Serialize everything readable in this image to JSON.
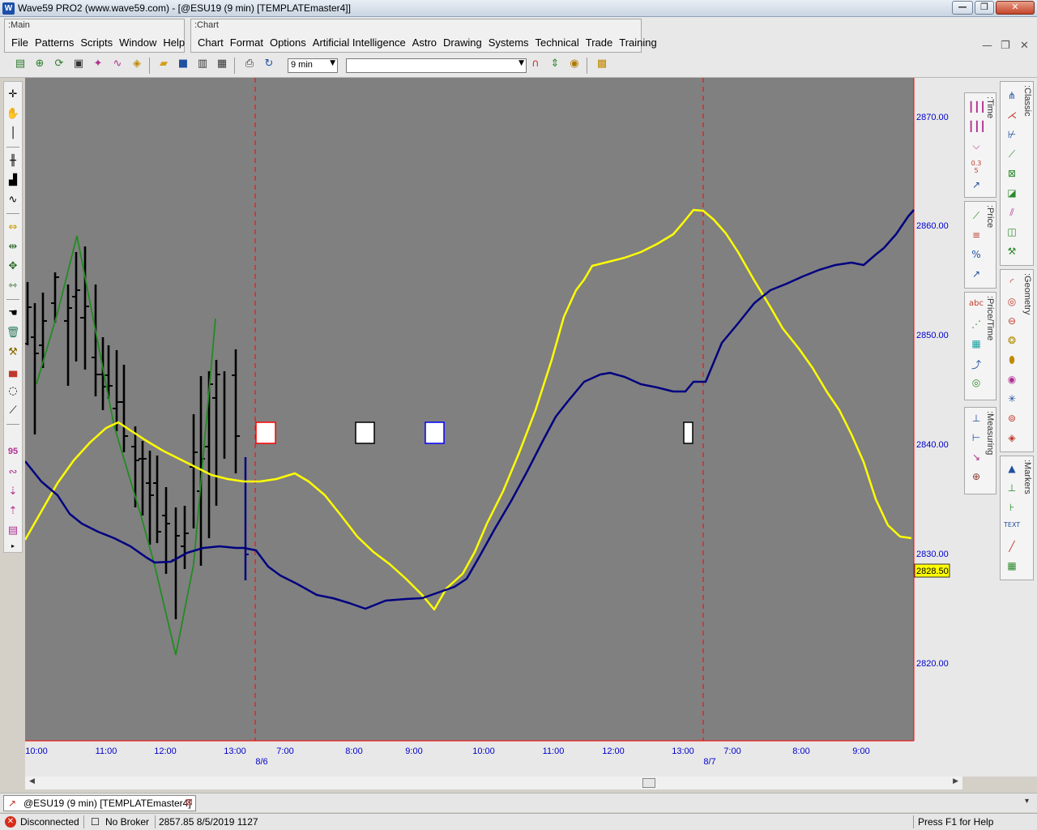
{
  "window": {
    "title": "Wave59 PRO2 (www.wave59.com) - [@ESU19 (9 min) [TEMPLATEmaster4]]",
    "app_icon": "W"
  },
  "menus": {
    "main_group_label": ":Main",
    "main_items": [
      "File",
      "Patterns",
      "Scripts",
      "Window",
      "Help"
    ],
    "chart_group_label": ":Chart",
    "chart_items": [
      "Chart",
      "Format",
      "Options",
      "Artificial Intelligence",
      "Astro",
      "Drawing",
      "Systems",
      "Technical",
      "Trade",
      "Training"
    ]
  },
  "toolbar": {
    "timeframe_value": "9 min",
    "symbol_value": ""
  },
  "left_toolbar": {
    "wave_label": "95"
  },
  "side_panels": {
    "classic_label": ":Classic",
    "time_label": ":Time",
    "price_label": ":Price",
    "geometry_label": ":Geometry",
    "pricetime_label": ":Price/Time",
    "measuring_label": ":Measuring",
    "markers_label": ":Markers",
    "percent_glyph": "%",
    "abc_glyph": "abc",
    "text_glyph": "TEXT",
    "fib_glyph": "0.3 5"
  },
  "chart_data": {
    "type": "line",
    "symbol": "@ESU19",
    "timeframe": "9 min",
    "y_ticks": [
      "2870.00",
      "2860.00",
      "2850.00",
      "2840.00",
      "2830.00",
      "2820.00"
    ],
    "ylim": [
      2813,
      2874
    ],
    "current_price_label": "2828.50",
    "x_tick_labels": [
      "10:00",
      "11:00",
      "12:00",
      "13:00",
      "7:00",
      "8:00",
      "9:00",
      "10:00",
      "11:00",
      "12:00",
      "13:00",
      "7:00",
      "8:00",
      "9:00"
    ],
    "date_labels": [
      "8/6",
      "8/7"
    ],
    "colors": {
      "background": "#808080",
      "yellow_line": "#ffff00",
      "navy_line": "#000080",
      "zigzag": "#228b22",
      "bars": "#000000",
      "session_divider": "#ff0000",
      "axis_text": "#0000cc"
    },
    "session_dividers_price_axis": true,
    "markers": [
      {
        "type": "square",
        "border": "#ff0000",
        "fill": "#ffffff"
      },
      {
        "type": "square",
        "border": "#000000",
        "fill": "#ffffff"
      },
      {
        "type": "square",
        "border": "#0000ff",
        "fill": "#ffffff"
      },
      {
        "type": "rect",
        "border": "#000000",
        "fill": "#ffffff"
      }
    ]
  },
  "tabs": {
    "chart_tab_label": "@ESU19 (9 min) [TEMPLATEmaster4]"
  },
  "status": {
    "connection": "Disconnected",
    "broker": "No Broker",
    "last": "2857.85  8/5/2019  1127",
    "help": "Press F1 for Help"
  }
}
